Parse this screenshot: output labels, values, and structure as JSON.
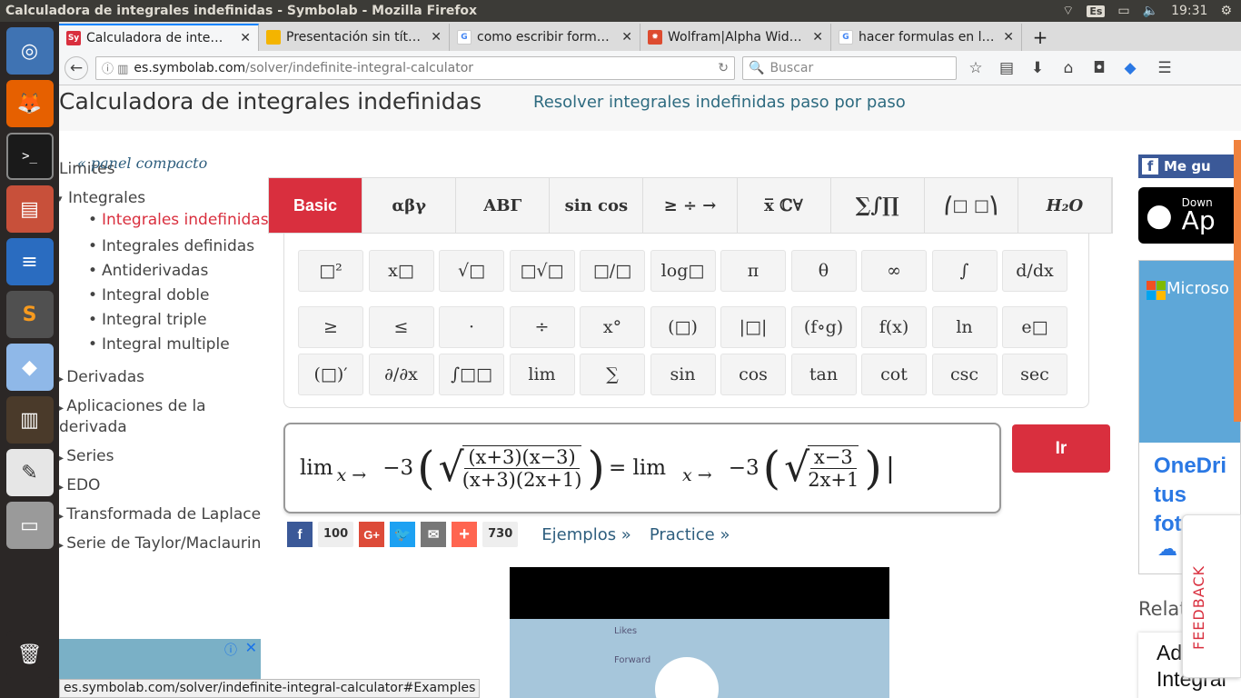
{
  "os": {
    "window_title": "Calculadora de integrales indefinidas - Symbolab - Mozilla Firefox",
    "kbd": "Es",
    "clock": "19:31"
  },
  "launcher": [
    "ubuntu-icon",
    "firefox-icon",
    "terminal-icon",
    "files-icon",
    "writer-icon",
    "sublime-icon",
    "cube-icon",
    "books-icon",
    "text-editor-icon",
    "drive-icon",
    "trash-icon"
  ],
  "tabs": [
    {
      "label": "Calculadora de inte…",
      "favicon": "Sy",
      "color": "#d92f3e"
    },
    {
      "label": "Presentación sin tít…",
      "favicon": "",
      "color": "#f4b400"
    },
    {
      "label": "como escribir form…",
      "favicon": "G",
      "color": "#4285f4"
    },
    {
      "label": "Wolfram|Alpha Wid…",
      "favicon": "✹",
      "color": "#dd4b2f"
    },
    {
      "label": "hacer formulas en l…",
      "favicon": "G",
      "color": "#4285f4"
    }
  ],
  "nav": {
    "url_host": "es.symbolab.com",
    "url_path": "/solver/indefinite-integral-calculator",
    "search_placeholder": "Buscar"
  },
  "header": {
    "title": "Calculadora de integrales indefinidas",
    "subtitle": "Resolver integrales indefinidas paso por paso"
  },
  "sidebar": {
    "limites": "Limites",
    "integrales": "Integrales",
    "integrales_items": [
      "Integrales indefinidas",
      "Integrales definidas",
      "Antiderivadas",
      "Integral doble",
      "Integral triple",
      "Integral multiple"
    ],
    "others": [
      "Derivadas",
      "Aplicaciones de la derivada",
      "Series",
      "EDO",
      "Transformada de Laplace",
      "Serie de Taylor/Maclaurin"
    ]
  },
  "keyboard": {
    "compact": "« panel compacto",
    "tabs": [
      "Basic",
      "αβγ",
      "ΑΒΓ",
      "sin cos",
      "≥ ÷ →",
      "x̅ ℂ∀",
      "∑∫∏",
      "⎛□ □⎞",
      "H₂O"
    ],
    "rows": [
      [
        "□²",
        "x□",
        "√□",
        "□√□",
        "□/□",
        "log□",
        "π",
        "θ",
        "∞",
        "∫",
        "d/dx"
      ],
      [
        "≥",
        "≤",
        "·",
        "÷",
        "x°",
        "(□)",
        "|□|",
        "(f∘g)",
        "f(x)",
        "ln",
        "e□"
      ],
      [
        "(□)′",
        "∂/∂x",
        "∫□□",
        "lim",
        "∑",
        "sin",
        "cos",
        "tan",
        "cot",
        "csc",
        "sec"
      ]
    ]
  },
  "input": {
    "lim": "lim",
    "arrow": "x →",
    "lim_to": "−3",
    "num1": "(x+3)(x−3)",
    "den1": "(x+3)(2x+1)",
    "equals": "= lim",
    "num2": "x−3",
    "den2": "2x+1"
  },
  "go_label": "Ir",
  "share": {
    "facebook_count": "100",
    "plus_count": "730",
    "examples": "Ejemplos »",
    "practice": "Practice »"
  },
  "ad": {
    "like": "Me gu",
    "download": "Down",
    "app": "Ap",
    "microsoft": "Microso",
    "onedrive": "OneDri",
    "fotos": "tus foto",
    "related": "Relat",
    "advanced": "Advanc",
    "integral": "Integral",
    "video_likes": "Likes",
    "video_forward": "Forward"
  },
  "feedback": "FEEDBACK",
  "status_url": "es.symbolab.com/solver/indefinite-integral-calculator#Examples"
}
